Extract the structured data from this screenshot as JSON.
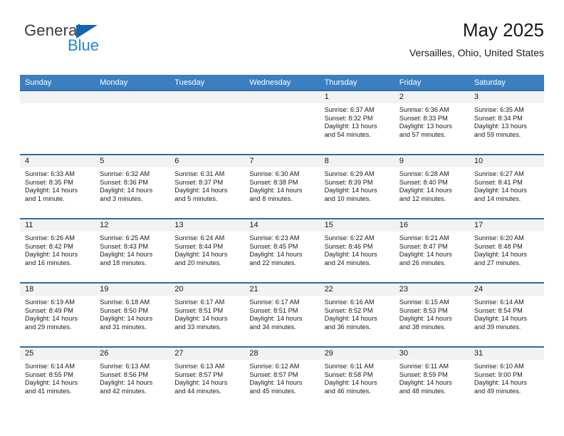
{
  "brand": {
    "name_part1": "General",
    "name_part2": "Blue",
    "logo_accent_color": "#1565b0",
    "text_color": "#2585d3"
  },
  "header": {
    "title": "May 2025",
    "subtitle": "Versailles, Ohio, United States"
  },
  "theme": {
    "header_row_bg": "#3c7fc1",
    "week_separator": "#2e6da4",
    "daynum_band_bg": "#f2f2f2"
  },
  "weekdays": [
    "Sunday",
    "Monday",
    "Tuesday",
    "Wednesday",
    "Thursday",
    "Friday",
    "Saturday"
  ],
  "labels": {
    "sunrise_prefix": "Sunrise:",
    "sunset_prefix": "Sunset:",
    "daylight_prefix": "Daylight:"
  },
  "weeks": [
    [
      {
        "day": "",
        "empty": true
      },
      {
        "day": "",
        "empty": true
      },
      {
        "day": "",
        "empty": true
      },
      {
        "day": "",
        "empty": true
      },
      {
        "day": "1",
        "sunrise": "Sunrise: 6:37 AM",
        "sunset": "Sunset: 8:32 PM",
        "daylight_line1": "Daylight: 13 hours",
        "daylight_line2": "and 54 minutes."
      },
      {
        "day": "2",
        "sunrise": "Sunrise: 6:36 AM",
        "sunset": "Sunset: 8:33 PM",
        "daylight_line1": "Daylight: 13 hours",
        "daylight_line2": "and 57 minutes."
      },
      {
        "day": "3",
        "sunrise": "Sunrise: 6:35 AM",
        "sunset": "Sunset: 8:34 PM",
        "daylight_line1": "Daylight: 13 hours",
        "daylight_line2": "and 59 minutes."
      }
    ],
    [
      {
        "day": "4",
        "sunrise": "Sunrise: 6:33 AM",
        "sunset": "Sunset: 8:35 PM",
        "daylight_line1": "Daylight: 14 hours",
        "daylight_line2": "and 1 minute."
      },
      {
        "day": "5",
        "sunrise": "Sunrise: 6:32 AM",
        "sunset": "Sunset: 8:36 PM",
        "daylight_line1": "Daylight: 14 hours",
        "daylight_line2": "and 3 minutes."
      },
      {
        "day": "6",
        "sunrise": "Sunrise: 6:31 AM",
        "sunset": "Sunset: 8:37 PM",
        "daylight_line1": "Daylight: 14 hours",
        "daylight_line2": "and 5 minutes."
      },
      {
        "day": "7",
        "sunrise": "Sunrise: 6:30 AM",
        "sunset": "Sunset: 8:38 PM",
        "daylight_line1": "Daylight: 14 hours",
        "daylight_line2": "and 8 minutes."
      },
      {
        "day": "8",
        "sunrise": "Sunrise: 6:29 AM",
        "sunset": "Sunset: 8:39 PM",
        "daylight_line1": "Daylight: 14 hours",
        "daylight_line2": "and 10 minutes."
      },
      {
        "day": "9",
        "sunrise": "Sunrise: 6:28 AM",
        "sunset": "Sunset: 8:40 PM",
        "daylight_line1": "Daylight: 14 hours",
        "daylight_line2": "and 12 minutes."
      },
      {
        "day": "10",
        "sunrise": "Sunrise: 6:27 AM",
        "sunset": "Sunset: 8:41 PM",
        "daylight_line1": "Daylight: 14 hours",
        "daylight_line2": "and 14 minutes."
      }
    ],
    [
      {
        "day": "11",
        "sunrise": "Sunrise: 6:26 AM",
        "sunset": "Sunset: 8:42 PM",
        "daylight_line1": "Daylight: 14 hours",
        "daylight_line2": "and 16 minutes."
      },
      {
        "day": "12",
        "sunrise": "Sunrise: 6:25 AM",
        "sunset": "Sunset: 8:43 PM",
        "daylight_line1": "Daylight: 14 hours",
        "daylight_line2": "and 18 minutes."
      },
      {
        "day": "13",
        "sunrise": "Sunrise: 6:24 AM",
        "sunset": "Sunset: 8:44 PM",
        "daylight_line1": "Daylight: 14 hours",
        "daylight_line2": "and 20 minutes."
      },
      {
        "day": "14",
        "sunrise": "Sunrise: 6:23 AM",
        "sunset": "Sunset: 8:45 PM",
        "daylight_line1": "Daylight: 14 hours",
        "daylight_line2": "and 22 minutes."
      },
      {
        "day": "15",
        "sunrise": "Sunrise: 6:22 AM",
        "sunset": "Sunset: 8:46 PM",
        "daylight_line1": "Daylight: 14 hours",
        "daylight_line2": "and 24 minutes."
      },
      {
        "day": "16",
        "sunrise": "Sunrise: 6:21 AM",
        "sunset": "Sunset: 8:47 PM",
        "daylight_line1": "Daylight: 14 hours",
        "daylight_line2": "and 26 minutes."
      },
      {
        "day": "17",
        "sunrise": "Sunrise: 6:20 AM",
        "sunset": "Sunset: 8:48 PM",
        "daylight_line1": "Daylight: 14 hours",
        "daylight_line2": "and 27 minutes."
      }
    ],
    [
      {
        "day": "18",
        "sunrise": "Sunrise: 6:19 AM",
        "sunset": "Sunset: 8:49 PM",
        "daylight_line1": "Daylight: 14 hours",
        "daylight_line2": "and 29 minutes."
      },
      {
        "day": "19",
        "sunrise": "Sunrise: 6:18 AM",
        "sunset": "Sunset: 8:50 PM",
        "daylight_line1": "Daylight: 14 hours",
        "daylight_line2": "and 31 minutes."
      },
      {
        "day": "20",
        "sunrise": "Sunrise: 6:17 AM",
        "sunset": "Sunset: 8:51 PM",
        "daylight_line1": "Daylight: 14 hours",
        "daylight_line2": "and 33 minutes."
      },
      {
        "day": "21",
        "sunrise": "Sunrise: 6:17 AM",
        "sunset": "Sunset: 8:51 PM",
        "daylight_line1": "Daylight: 14 hours",
        "daylight_line2": "and 34 minutes."
      },
      {
        "day": "22",
        "sunrise": "Sunrise: 6:16 AM",
        "sunset": "Sunset: 8:52 PM",
        "daylight_line1": "Daylight: 14 hours",
        "daylight_line2": "and 36 minutes."
      },
      {
        "day": "23",
        "sunrise": "Sunrise: 6:15 AM",
        "sunset": "Sunset: 8:53 PM",
        "daylight_line1": "Daylight: 14 hours",
        "daylight_line2": "and 38 minutes."
      },
      {
        "day": "24",
        "sunrise": "Sunrise: 6:14 AM",
        "sunset": "Sunset: 8:54 PM",
        "daylight_line1": "Daylight: 14 hours",
        "daylight_line2": "and 39 minutes."
      }
    ],
    [
      {
        "day": "25",
        "sunrise": "Sunrise: 6:14 AM",
        "sunset": "Sunset: 8:55 PM",
        "daylight_line1": "Daylight: 14 hours",
        "daylight_line2": "and 41 minutes."
      },
      {
        "day": "26",
        "sunrise": "Sunrise: 6:13 AM",
        "sunset": "Sunset: 8:56 PM",
        "daylight_line1": "Daylight: 14 hours",
        "daylight_line2": "and 42 minutes."
      },
      {
        "day": "27",
        "sunrise": "Sunrise: 6:13 AM",
        "sunset": "Sunset: 8:57 PM",
        "daylight_line1": "Daylight: 14 hours",
        "daylight_line2": "and 44 minutes."
      },
      {
        "day": "28",
        "sunrise": "Sunrise: 6:12 AM",
        "sunset": "Sunset: 8:57 PM",
        "daylight_line1": "Daylight: 14 hours",
        "daylight_line2": "and 45 minutes."
      },
      {
        "day": "29",
        "sunrise": "Sunrise: 6:11 AM",
        "sunset": "Sunset: 8:58 PM",
        "daylight_line1": "Daylight: 14 hours",
        "daylight_line2": "and 46 minutes."
      },
      {
        "day": "30",
        "sunrise": "Sunrise: 6:11 AM",
        "sunset": "Sunset: 8:59 PM",
        "daylight_line1": "Daylight: 14 hours",
        "daylight_line2": "and 48 minutes."
      },
      {
        "day": "31",
        "sunrise": "Sunrise: 6:10 AM",
        "sunset": "Sunset: 9:00 PM",
        "daylight_line1": "Daylight: 14 hours",
        "daylight_line2": "and 49 minutes."
      }
    ]
  ]
}
